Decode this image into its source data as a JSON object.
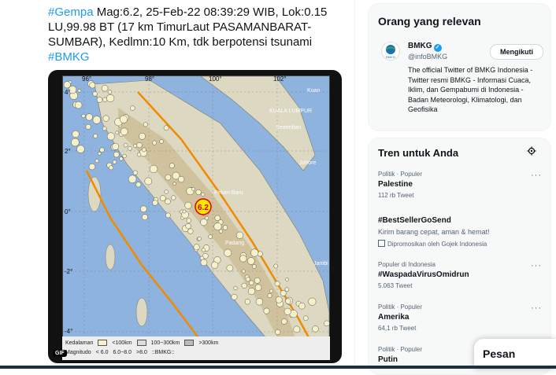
{
  "tweet": {
    "text_parts": [
      {
        "t": "#Gempa",
        "hash": true
      },
      {
        "t": " Mag:6.2, 25-Feb-22 08:39:29 WIB, Lok:0.15 LU,99.98 BT (17 km TimurLaut PASAMANBARAT-SUMBAR), Kedlmn:10 Km, tdk berpotensi tsunami",
        "hash": false
      },
      {
        "t": "#BMKG",
        "hash": true
      }
    ]
  },
  "map": {
    "lon_labels": [
      "96°",
      "98°",
      "100°",
      "102°"
    ],
    "lat_labels": [
      "4°",
      "2°",
      "0°",
      "-2°",
      "-4°"
    ],
    "places": [
      "KUALA LUMPUR",
      "Seremban",
      "Johore",
      "Pekan Baru",
      "Padang",
      "Jambi",
      "Kuan"
    ],
    "epicenter_label": "6.2",
    "gif_badge": "GIF",
    "legend": {
      "depth_label": "Kedalaman",
      "depth_items": [
        "<100km",
        "100~300km",
        ">300km"
      ],
      "mag_label": "Magnitudo",
      "mag_items": [
        "< 6.0",
        "6.0~8.0",
        ">8.0"
      ],
      "credit": "::BMKG::"
    }
  },
  "relevant": {
    "title": "Orang yang relevan",
    "name": "BMKG",
    "handle": "@infoBMKG",
    "follow_label": "Mengikuti",
    "bio": "The official Twitter of BMKG Indonesia - Twitter resmi BMKG - Informasi Cuaca, Iklim, dan Gempabumi di Indonesia - Badan Meteorologi, Klimatologi, dan Geofisika",
    "verified_mark": "✓",
    "logo_text": "BMKG"
  },
  "trends": {
    "title": "Tren untuk Anda",
    "items": [
      {
        "meta": "Politik · Populer",
        "name": "Palestine",
        "count": "112 rb Tweet"
      },
      {
        "meta": "",
        "name": "#BestSellerGoSend",
        "desc": "Kirim barang cepat, aman & hemat!",
        "promo": "Dipromosikan oleh Gojek Indonesia"
      },
      {
        "meta": "Populer di Indonesia",
        "name": "#WaspadaVirusOmidrun",
        "count": "5.063 Tweet"
      },
      {
        "meta": "Politik · Populer",
        "name": "Amerika",
        "count": "64,1 rb Tweet"
      },
      {
        "meta": "Politik · Populer",
        "name": "Putin",
        "count": ""
      }
    ],
    "more_glyph": "···"
  },
  "messages": {
    "label": "Pesan"
  },
  "colors": {
    "accent": "#1d9bf0",
    "text": "#0f1419",
    "muted": "#536471"
  }
}
